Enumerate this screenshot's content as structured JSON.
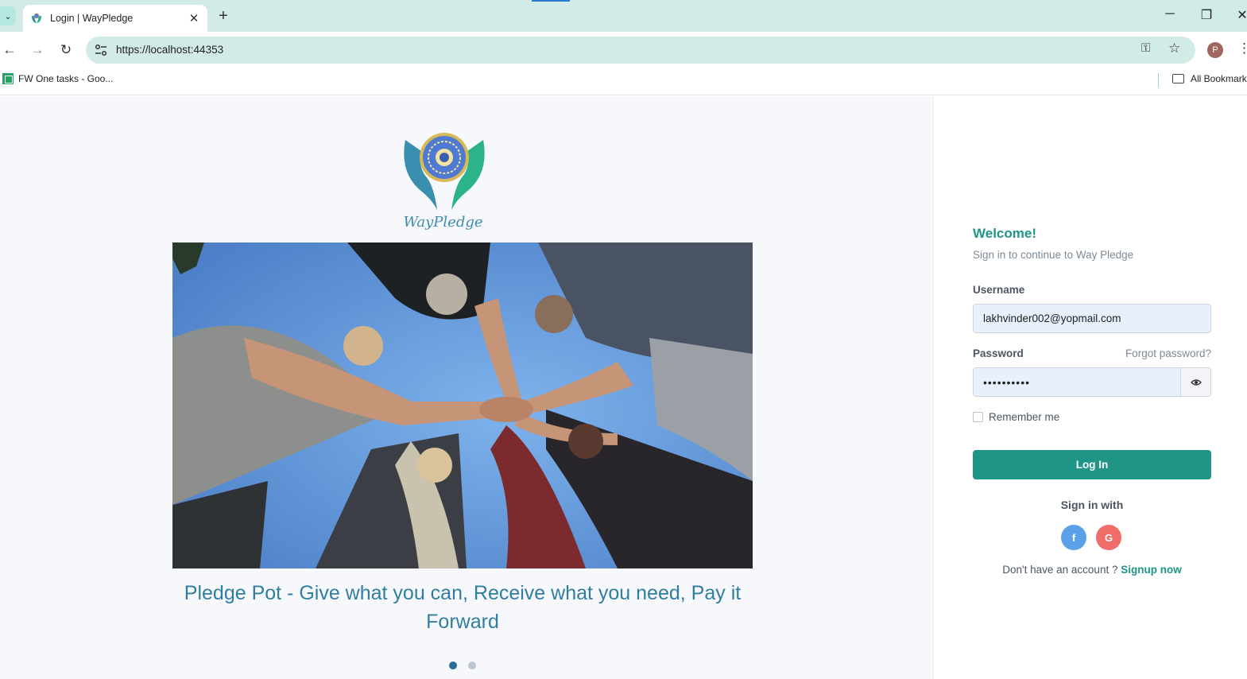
{
  "browser": {
    "tab_title": "Login | WayPledge",
    "tab_close": "✕",
    "new_tab": "+",
    "url": "https://localhost:44353",
    "profile_initial": "P",
    "bookmarks": [
      {
        "label": "FW One tasks - Goo...",
        "icon": "sheets-icon"
      }
    ],
    "all_bookmarks_label": "All Bookmark",
    "window_controls": {
      "minimize": "─",
      "restore": "❐",
      "close": "✕"
    },
    "nav": {
      "back": "←",
      "forward": "→",
      "reload": "↻"
    }
  },
  "brand": {
    "logo_text": "WayPledge",
    "colors": {
      "primary": "#1e9587",
      "caption": "#2f7ea2",
      "logo_blue": "#3d8cab",
      "logo_green": "#2db38a"
    }
  },
  "carousel": {
    "caption": "Pledge Pot - Give what you can, Receive what you need, Pay it Forward",
    "slide_count": 2,
    "active_slide": 1
  },
  "login": {
    "welcome": "Welcome!",
    "subtitle": "Sign in to continue to Way Pledge",
    "username_label": "Username",
    "username_value": "lakhvinder002@yopmail.com",
    "password_label": "Password",
    "password_value": "••••••••••",
    "forgot_password": "Forgot password?",
    "remember_me": "Remember me",
    "remember_checked": false,
    "login_button": "Log In",
    "sign_in_with": "Sign in with",
    "social": [
      {
        "name": "facebook",
        "glyph": "f",
        "color": "#5aa1e8"
      },
      {
        "name": "google",
        "glyph": "G",
        "color": "#f06d6a"
      }
    ],
    "no_account_text": "Don't have an account ? ",
    "signup_link": "Signup now"
  }
}
